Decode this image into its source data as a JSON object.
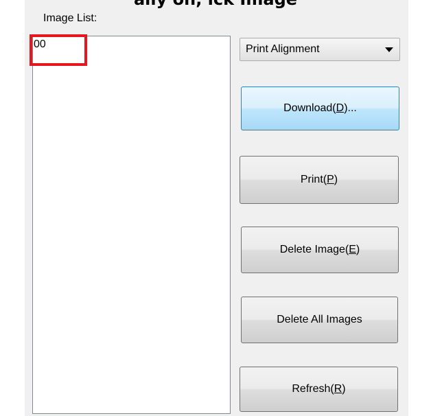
{
  "top_title_fragment": "ally on, ick Image",
  "image_list": {
    "label": "Image List:",
    "items": [
      "00"
    ]
  },
  "mode_select": {
    "value": "Print Alignment"
  },
  "buttons": {
    "download": {
      "pre": "Download(",
      "mnemonic": "D",
      "post": ")..."
    },
    "print": {
      "pre": "Print(",
      "mnemonic": "P",
      "post": ")"
    },
    "delete_image": {
      "pre": "Delete Image(",
      "mnemonic": "E",
      "post": ")"
    },
    "delete_all": {
      "label": "Delete All Images"
    },
    "refresh": {
      "pre": "Refresh(",
      "mnemonic": "R",
      "post": ")"
    }
  },
  "colors": {
    "highlight": "#e8141e",
    "focus_border": "#3c7fb1",
    "panel_bg": "#f0f0f0"
  },
  "icons": {
    "dropdown_arrow": "chevron-down-icon"
  }
}
